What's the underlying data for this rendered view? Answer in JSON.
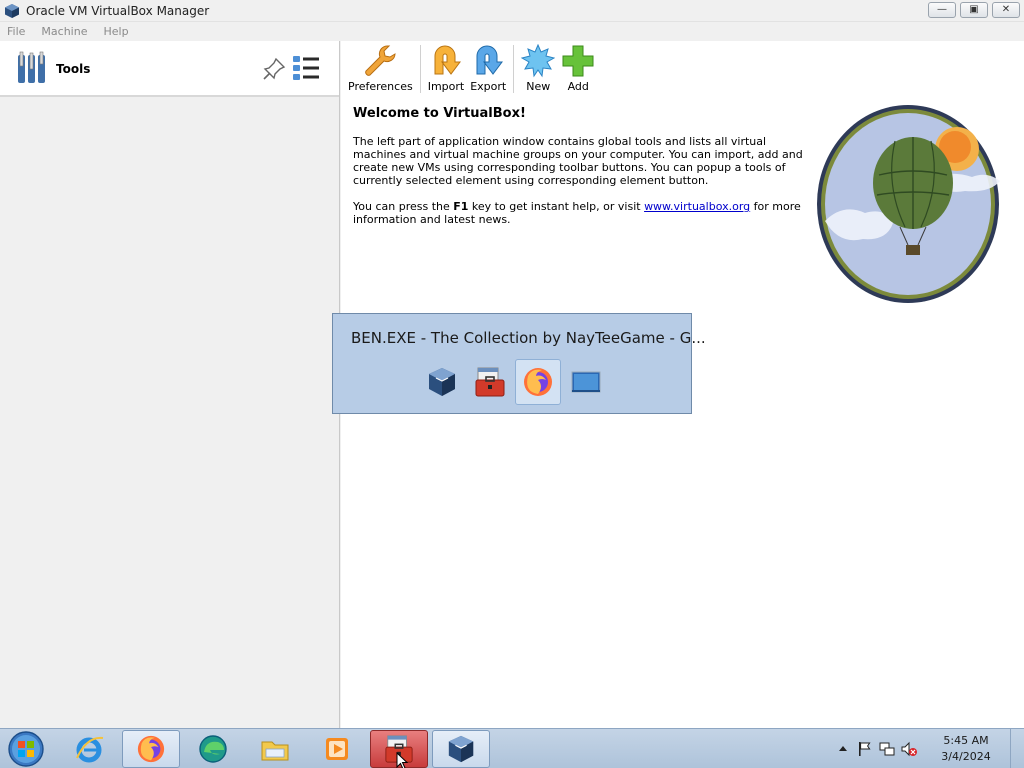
{
  "window": {
    "title": "Oracle VM VirtualBox Manager",
    "controls": {
      "minimize": "—",
      "maximize": "▣",
      "close": "✕"
    }
  },
  "menu": {
    "items": [
      "File",
      "Machine",
      "Help"
    ]
  },
  "sidebar": {
    "tools_label": "Tools"
  },
  "toolbar": {
    "preferences": "Preferences",
    "import": "Import",
    "export": "Export",
    "new": "New",
    "add": "Add"
  },
  "welcome": {
    "title": "Welcome to VirtualBox!",
    "para1": "The left part of application window contains global tools and lists all virtual machines and virtual machine groups on your computer. You can import, add and create new VMs using corresponding toolbar buttons. You can popup a tools of currently selected element using corresponding element button.",
    "para2_before": "You can press the ",
    "para2_key": "F1",
    "para2_mid": " key to get instant help, or visit ",
    "para2_link": "www.virtualbox.org",
    "para2_after": " for more information and latest news."
  },
  "switcher": {
    "title": "BEN.EXE - The Collection by NayTeeGame - G...",
    "icons": [
      "virtualbox-icon",
      "toolbox-icon",
      "firefox-icon",
      "desktop-icon"
    ],
    "selected_index": 2
  },
  "taskbar": {
    "items": [
      "internet-explorer-icon",
      "firefox-icon",
      "edge-icon",
      "file-explorer-icon",
      "media-player-icon",
      "toolbox-icon",
      "virtualbox-icon"
    ],
    "clock_time": "5:45 AM",
    "clock_date": "3/4/2024"
  },
  "colors": {
    "accent": "#2f6fb8",
    "switcher_bg": "#b7cce6",
    "taskbar_bg": "#aec3da"
  }
}
